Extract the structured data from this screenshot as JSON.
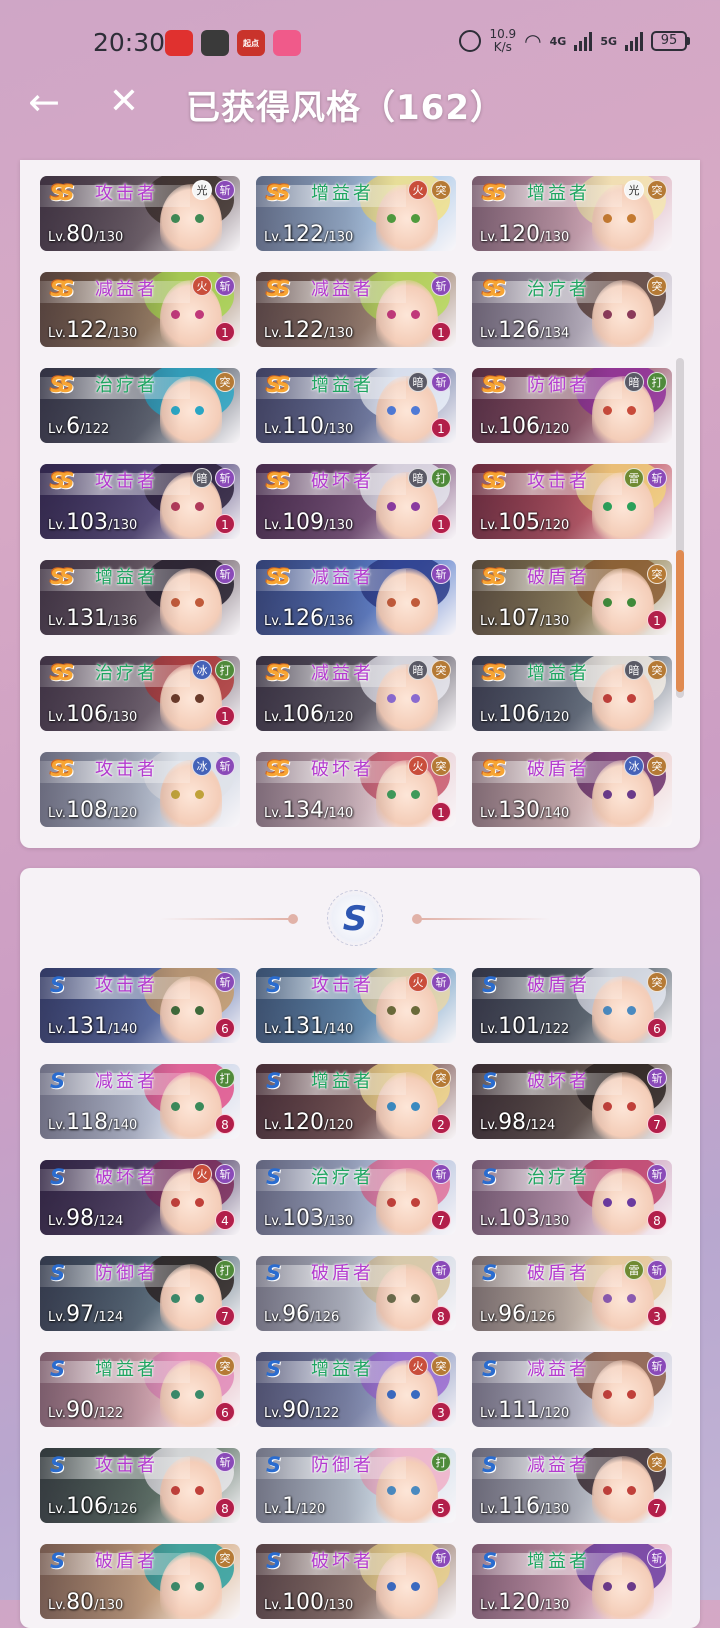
{
  "status_bar": {
    "time": "20:30",
    "net_speed_value": "10.9",
    "net_speed_unit": "K/s",
    "signal_1": "4G",
    "signal_2": "5G",
    "battery": "95",
    "apps": [
      {
        "icon": "news-app-icon",
        "color": "#e0312f"
      },
      {
        "icon": "camera-app-icon",
        "color": "#3a3a3a"
      },
      {
        "icon": "qidian-app-icon",
        "color": "#c9332b",
        "label": "起点"
      },
      {
        "icon": "pink-app-icon",
        "color": "#f05a8a"
      }
    ]
  },
  "header": {
    "back_icon": "back-arrow-icon",
    "close_icon": "close-icon",
    "title": "已获得风格（162）"
  },
  "ss_cards": [
    {
      "rank": "SS",
      "role": "攻击者",
      "role_color": "purple",
      "elements": [
        "光",
        "斩"
      ],
      "level": "80",
      "max": "/130",
      "count": "",
      "bg": "#5a4a52",
      "hair": "#3b2f2a",
      "eye": "#3f8a55"
    },
    {
      "rank": "SS",
      "role": "增益者",
      "role_color": "green",
      "elements": [
        "火",
        "突"
      ],
      "level": "122",
      "max": "/130",
      "count": "",
      "bg": "#9fc3e6",
      "hair": "#f1e08a",
      "eye": "#4f9b3e"
    },
    {
      "rank": "SS",
      "role": "增益者",
      "role_color": "green",
      "elements": [
        "光",
        "突"
      ],
      "level": "120",
      "max": "/130",
      "count": "",
      "bg": "#d7a3b3",
      "hair": "#f4e6b0",
      "eye": "#c47a30"
    },
    {
      "rank": "SS",
      "role": "减益者",
      "role_color": "purple",
      "elements": [
        "火",
        "斩"
      ],
      "level": "122",
      "max": "/130",
      "count": "1",
      "bg": "#8a6a45",
      "hair": "#a7d44f",
      "eye": "#c0397a"
    },
    {
      "rank": "SS",
      "role": "减益者",
      "role_color": "purple",
      "elements": [
        "斩"
      ],
      "level": "122",
      "max": "/130",
      "count": "1",
      "bg": "#8d6d55",
      "hair": "#b7da5a",
      "eye": "#c0397a"
    },
    {
      "rank": "SS",
      "role": "治疗者",
      "role_color": "green",
      "elements": [
        "突"
      ],
      "level": "126",
      "max": "/134",
      "count": "",
      "bg": "#b9b1c1",
      "hair": "#5a4037",
      "eye": "#8a3a5a"
    },
    {
      "rank": "SS",
      "role": "治疗者",
      "role_color": "green",
      "elements": [
        "突"
      ],
      "level": "6",
      "max": "/122",
      "count": "",
      "bg": "#3f4a58",
      "hair": "#2aa6c4",
      "eye": "#2aa6c4"
    },
    {
      "rank": "SS",
      "role": "增益者",
      "role_color": "green",
      "elements": [
        "暗",
        "斩"
      ],
      "level": "110",
      "max": "/130",
      "count": "1",
      "bg": "#5a6a9a",
      "hair": "#e9eef8",
      "eye": "#4f7ad6"
    },
    {
      "rank": "SS",
      "role": "防御者",
      "role_color": "purple",
      "elements": [
        "暗",
        "打"
      ],
      "level": "106",
      "max": "/120",
      "count": "",
      "bg": "#8a3f55",
      "hair": "#8f2f9a",
      "eye": "#c84a3a"
    },
    {
      "rank": "SS",
      "role": "攻击者",
      "role_color": "purple",
      "elements": [
        "暗",
        "斩"
      ],
      "level": "103",
      "max": "/130",
      "count": "1",
      "bg": "#3b2f6a",
      "hair": "#2a1f3a",
      "eye": "#b03a5a"
    },
    {
      "rank": "SS",
      "role": "破坏者",
      "role_color": "purple",
      "elements": [
        "暗",
        "打"
      ],
      "level": "109",
      "max": "/130",
      "count": "1",
      "bg": "#6a3a6a",
      "hair": "#e4e4ec",
      "eye": "#8a3aa0"
    },
    {
      "rank": "SS",
      "role": "攻击者",
      "role_color": "purple",
      "elements": [
        "雷",
        "斩"
      ],
      "level": "105",
      "max": "/120",
      "count": "",
      "bg": "#b83a4a",
      "hair": "#f1d07a",
      "eye": "#2aa05a"
    },
    {
      "rank": "SS",
      "role": "增益者",
      "role_color": "green",
      "elements": [
        "斩"
      ],
      "level": "131",
      "max": "/136",
      "count": "",
      "bg": "#5a4a55",
      "hair": "#221c2a",
      "eye": "#c05a3a"
    },
    {
      "rank": "SS",
      "role": "减益者",
      "role_color": "purple",
      "elements": [
        "斩"
      ],
      "level": "126",
      "max": "/136",
      "count": "",
      "bg": "#3f6ac4",
      "hair": "#2a3b8a",
      "eye": "#c05a3a"
    },
    {
      "rank": "SS",
      "role": "破盾者",
      "role_color": "purple",
      "elements": [
        "突"
      ],
      "level": "107",
      "max": "/130",
      "count": "1",
      "bg": "#8a7a45",
      "hair": "#8a5a2f",
      "eye": "#3f8a3a"
    },
    {
      "rank": "SS",
      "role": "治疗者",
      "role_color": "green",
      "elements": [
        "冰",
        "打"
      ],
      "level": "106",
      "max": "/130",
      "count": "1",
      "bg": "#5a4a58",
      "hair": "#b03a3a",
      "eye": "#6a3a2a"
    },
    {
      "rank": "SS",
      "role": "减益者",
      "role_color": "purple",
      "elements": [
        "暗",
        "突"
      ],
      "level": "106",
      "max": "/120",
      "count": "",
      "bg": "#4a4652",
      "hair": "#e8e8ee",
      "eye": "#8a6ad0"
    },
    {
      "rank": "SS",
      "role": "增益者",
      "role_color": "green",
      "elements": [
        "暗",
        "突"
      ],
      "level": "106",
      "max": "/120",
      "count": "",
      "bg": "#4a5a6a",
      "hair": "#f2ece4",
      "eye": "#c0403a"
    },
    {
      "rank": "SS",
      "role": "攻击者",
      "role_color": "purple",
      "elements": [
        "冰",
        "斩"
      ],
      "level": "108",
      "max": "/120",
      "count": "",
      "bg": "#b8c6d8",
      "hair": "#dfe3ea",
      "eye": "#c0a23a"
    },
    {
      "rank": "SS",
      "role": "破坏者",
      "role_color": "purple",
      "elements": [
        "火",
        "突"
      ],
      "level": "134",
      "max": "/140",
      "count": "1",
      "bg": "#e6c6cc",
      "hair": "#c8566a",
      "eye": "#3f9a5a"
    },
    {
      "rank": "SS",
      "role": "破盾者",
      "role_color": "purple",
      "elements": [
        "冰",
        "突"
      ],
      "level": "130",
      "max": "/140",
      "count": "",
      "bg": "#e9c3c0",
      "hair": "#6a2f6a",
      "eye": "#6a3a8a"
    }
  ],
  "s_section": {
    "emblem": "S"
  },
  "s_cards": [
    {
      "rank": "S",
      "role": "攻击者",
      "role_color": "purple",
      "elements": [
        "斩"
      ],
      "level": "131",
      "max": "/140",
      "count": "6",
      "bg": "#3f5aa0",
      "hair": "#c49a6a",
      "eye": "#3f6a3a"
    },
    {
      "rank": "S",
      "role": "攻击者",
      "role_color": "purple",
      "elements": [
        "火",
        "斩"
      ],
      "level": "131",
      "max": "/140",
      "count": "",
      "bg": "#4f8ab8",
      "hair": "#e8d6a8",
      "eye": "#6a6a3a"
    },
    {
      "rank": "S",
      "role": "破盾者",
      "role_color": "purple",
      "elements": [
        "突"
      ],
      "level": "101",
      "max": "/122",
      "count": "6",
      "bg": "#3f4f5a",
      "hair": "#e3e6f0",
      "eye": "#4a8ac0"
    },
    {
      "rank": "S",
      "role": "减益者",
      "role_color": "purple",
      "elements": [
        "打"
      ],
      "level": "118",
      "max": "/140",
      "count": "8",
      "bg": "#c3d0e6",
      "hair": "#e0508a",
      "eye": "#3a8a5a"
    },
    {
      "rank": "S",
      "role": "增益者",
      "role_color": "green",
      "elements": [
        "突"
      ],
      "level": "120",
      "max": "/120",
      "count": "2",
      "bg": "#6a3f3a",
      "hair": "#f1d68a",
      "eye": "#3a8ac0"
    },
    {
      "rank": "S",
      "role": "破坏者",
      "role_color": "purple",
      "elements": [
        "斩"
      ],
      "level": "98",
      "max": "/124",
      "count": "7",
      "bg": "#4a3a2f",
      "hair": "#2a2220",
      "eye": "#c0403a"
    },
    {
      "rank": "S",
      "role": "破坏者",
      "role_color": "purple",
      "elements": [
        "火",
        "斩"
      ],
      "level": "98",
      "max": "/124",
      "count": "4",
      "bg": "#3a2a55",
      "hair": "#7a2a5a",
      "eye": "#c0403a"
    },
    {
      "rank": "S",
      "role": "治疗者",
      "role_color": "green",
      "elements": [
        "斩"
      ],
      "level": "103",
      "max": "/130",
      "count": "7",
      "bg": "#a7b8d8",
      "hair": "#e0709a",
      "eye": "#c0403a"
    },
    {
      "rank": "S",
      "role": "治疗者",
      "role_color": "green",
      "elements": [
        "斩"
      ],
      "level": "103",
      "max": "/130",
      "count": "8",
      "bg": "#c99ab8",
      "hair": "#c0406a",
      "eye": "#6a3aa0"
    },
    {
      "rank": "S",
      "role": "防御者",
      "role_color": "purple",
      "elements": [
        "打"
      ],
      "level": "97",
      "max": "/124",
      "count": "7",
      "bg": "#3f5a6a",
      "hair": "#2a2220",
      "eye": "#3a8a6a"
    },
    {
      "rank": "S",
      "role": "破盾者",
      "role_color": "purple",
      "elements": [
        "斩"
      ],
      "level": "96",
      "max": "/126",
      "count": "8",
      "bg": "#c9d3df",
      "hair": "#d8c6a0",
      "eye": "#6a6a4a"
    },
    {
      "rank": "S",
      "role": "破盾者",
      "role_color": "purple",
      "elements": [
        "雷",
        "斩"
      ],
      "level": "96",
      "max": "/126",
      "count": "3",
      "bg": "#d6c6b0",
      "hair": "#e8c89a",
      "eye": "#8a5ab0"
    },
    {
      "rank": "S",
      "role": "增益者",
      "role_color": "green",
      "elements": [
        "突"
      ],
      "level": "90",
      "max": "/122",
      "count": "6",
      "bg": "#e0a6b0",
      "hair": "#e08ab8",
      "eye": "#3a8a6a"
    },
    {
      "rank": "S",
      "role": "增益者",
      "role_color": "green",
      "elements": [
        "火",
        "突"
      ],
      "level": "90",
      "max": "/122",
      "count": "3",
      "bg": "#7a8ab8",
      "hair": "#9a6ad0",
      "eye": "#3a6ac0"
    },
    {
      "rank": "S",
      "role": "减益者",
      "role_color": "purple",
      "elements": [
        "斩"
      ],
      "level": "111",
      "max": "/120",
      "count": "",
      "bg": "#c3c6d8",
      "hair": "#8a5a45",
      "eye": "#c0403a"
    },
    {
      "rank": "S",
      "role": "攻击者",
      "role_color": "purple",
      "elements": [
        "斩"
      ],
      "level": "106",
      "max": "/126",
      "count": "8",
      "bg": "#3f5a4a",
      "hair": "#e8e6ea",
      "eye": "#c0403a"
    },
    {
      "rank": "S",
      "role": "防御者",
      "role_color": "purple",
      "elements": [
        "打"
      ],
      "level": "1",
      "max": "/120",
      "count": "5",
      "bg": "#c9dbe8",
      "hair": "#f0b0c8",
      "eye": "#4a8ac0"
    },
    {
      "rank": "S",
      "role": "减益者",
      "role_color": "purple",
      "elements": [
        "突"
      ],
      "level": "116",
      "max": "/130",
      "count": "7",
      "bg": "#b8c0ca",
      "hair": "#3a2a30",
      "eye": "#c0403a"
    },
    {
      "rank": "S",
      "role": "破盾者",
      "role_color": "purple",
      "elements": [
        "突"
      ],
      "level": "80",
      "max": "/130",
      "count": "",
      "bg": "#d0a070",
      "hair": "#2aa0a0",
      "eye": "#3a8a6a"
    },
    {
      "rank": "S",
      "role": "破坏者",
      "role_color": "purple",
      "elements": [
        "斩"
      ],
      "level": "100",
      "max": "/130",
      "count": "",
      "bg": "#8a6a5a",
      "hair": "#e8cf8a",
      "eye": "#3a6ac0"
    },
    {
      "rank": "S",
      "role": "增益者",
      "role_color": "green",
      "elements": [
        "斩"
      ],
      "level": "120",
      "max": "/130",
      "count": "",
      "bg": "#e0a0b8",
      "hair": "#6a3aa0",
      "eye": "#6a3a8a"
    }
  ],
  "scroll": {
    "position": 0.56
  }
}
